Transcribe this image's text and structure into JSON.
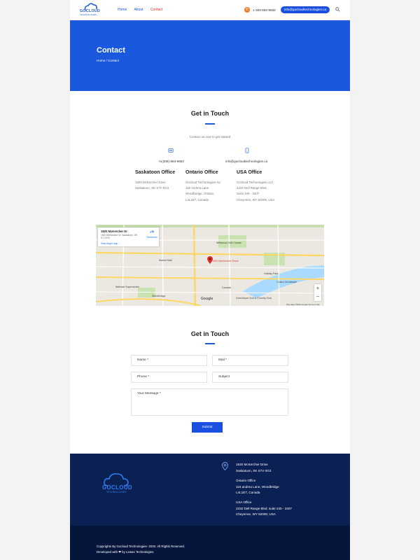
{
  "header": {
    "logo_word": "GOCLOUD",
    "logo_sub": "TECHNOLOGIES",
    "nav": [
      "Home",
      "About",
      "Contact"
    ],
    "active_nav": "Contact",
    "phone": "1-306-683-9682",
    "email": "info@gocloudtechnologies.ca",
    "icons": [
      "phone-icon",
      "search-icon"
    ]
  },
  "hero": {
    "title": "Contact",
    "breadcrumb": "Home / Contact"
  },
  "contact": {
    "heading": "Get in Touch",
    "subtext": "Contact us now to get started",
    "phone": "+1(306)-683-9682",
    "email": "info@gocloudtechnologies.ca",
    "offices": [
      {
        "title": "Saskatoon Office",
        "lines": [
          "1920 McKercher Drive",
          "Saskatoon, SK S7V 0G3"
        ]
      },
      {
        "title": "Ontario Office",
        "lines": [
          "Gocloud Technologies Inc",
          "116 Andrea Lane",
          "Woodbridge, Ontario",
          "L4L1E7, Canada"
        ]
      },
      {
        "title": "USA Office",
        "lines": [
          "Gocloud Technologies LLC",
          "2232 Dell Range Blvd.",
          "Suite 245 - 3407",
          "Cheyenne, WY 82009, USA"
        ]
      }
    ]
  },
  "map": {
    "card_title": "1920 McKercher Dr",
    "card_address": "1920 McKercher Dr, Saskatoon, SK S7J 5Y8",
    "card_link": "View larger map",
    "directions": "Directions",
    "pin_label": "1920 McKercher Drive",
    "labels": [
      "Wildwood Golf Course",
      "Market Mall",
      "Holiday Park",
      "Walmart Supercentre",
      "Stonebridge",
      "Greenbryre Golf & Country Club",
      "Costco Wholesale",
      "Canada"
    ],
    "google": "Google",
    "footer": "Map data ©2022 Google   Terms of Use",
    "zoom_in": "+",
    "zoom_out": "−"
  },
  "form": {
    "heading": "Get in Touch",
    "name": "Name *",
    "mail": "Mail *",
    "phone": "Phone *",
    "subject": "Subject",
    "message": "Your Message *",
    "submit": "Submit"
  },
  "footer": {
    "logo_word": "GOCLOUD",
    "logo_sub": "TECHNOLOGIES",
    "addr1": [
      "1920 McKercher Drive",
      "Saskatoon, SK S7V 0G3"
    ],
    "addr2": [
      "Ontario Office",
      "116 andrea Lane, Woodbridge",
      "L4L1E7, Canada"
    ],
    "addr3": [
      "USA Office",
      "2232 Dell Range Blvd, suite 245 - 3407",
      "Cheyenne, WY 82009, USA"
    ],
    "copyright": "Copyrights By Gocloud Technologies- 2020. All Rights Reserved.",
    "developed": "Developed with ❤ by Lewas Technologies"
  },
  "colors": {
    "brand_blue": "#1a58de",
    "footer_navy": "#0b2053",
    "active_red": "#e0312d"
  }
}
